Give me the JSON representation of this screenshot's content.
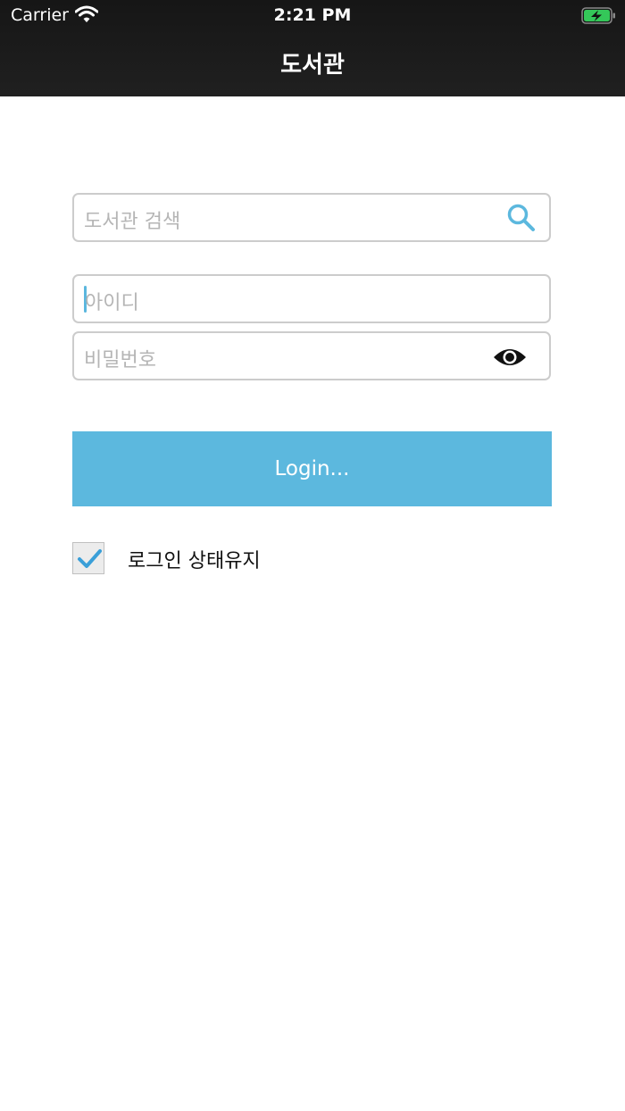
{
  "status_bar": {
    "carrier": "Carrier",
    "time": "2:21 PM",
    "icons": [
      "wifi-icon",
      "battery-charging-icon"
    ]
  },
  "nav": {
    "title": "도서관"
  },
  "search": {
    "placeholder": "도서관 검색",
    "icon": "search-icon"
  },
  "login_form": {
    "id_placeholder": "아이디",
    "password_placeholder": "비밀번호",
    "password_toggle_icon": "eye-icon",
    "login_label": "Login...",
    "remember_label": "로그인 상태유지",
    "remember_checked": true
  },
  "colors": {
    "accent": "#5cb8de",
    "topbar": "#1b1b1b",
    "battery": "#34c759"
  }
}
